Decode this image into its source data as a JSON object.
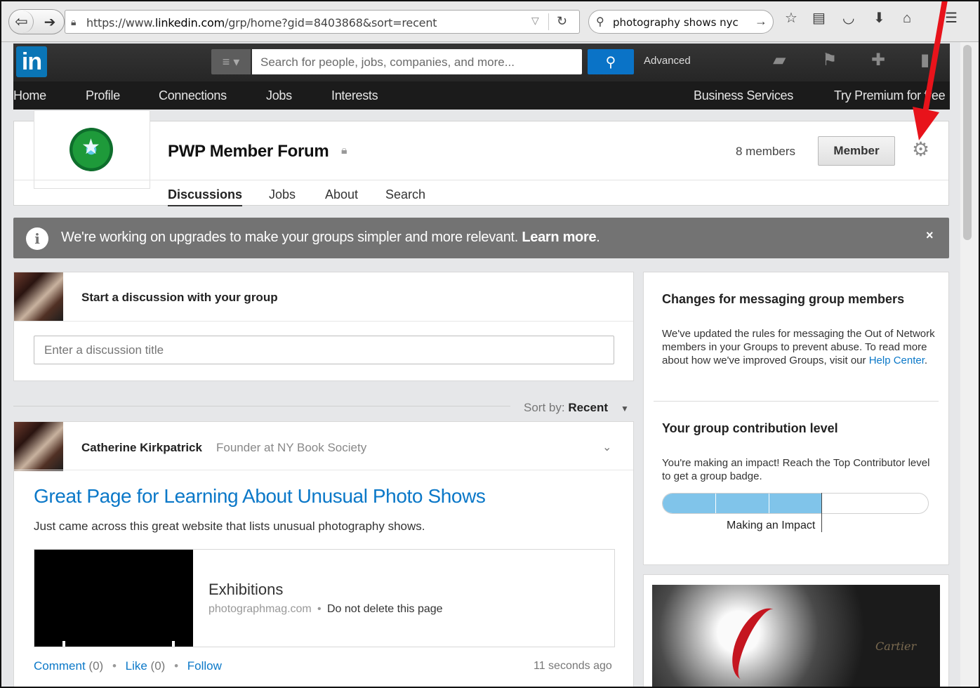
{
  "browser": {
    "url_prefix": "https://www.",
    "url_domain": "linkedin.com",
    "url_path": "/grp/home?gid=8403868&sort=recent",
    "search_query": "photography shows nyc"
  },
  "linkedin": {
    "logo": "in",
    "search_placeholder": "Search for people, jobs, companies, and more...",
    "advanced_label": "Advanced",
    "nav": [
      "Home",
      "Profile",
      "Connections",
      "Jobs",
      "Interests",
      "Business Services",
      "Try Premium for free"
    ]
  },
  "group": {
    "title": "PWP Member Forum",
    "members": "8 members",
    "member_button": "Member",
    "tabs": [
      "Discussions",
      "Jobs",
      "About",
      "Search"
    ]
  },
  "notice": {
    "text": "We're working on upgrades to make your groups simpler and more relevant.",
    "link": "Learn more",
    "suffix": ".",
    "close": "×"
  },
  "composer": {
    "title": "Start a discussion with your group",
    "placeholder": "Enter a discussion title"
  },
  "sort": {
    "label": "Sort by:",
    "value": "Recent"
  },
  "post": {
    "author": "Catherine Kirkpatrick",
    "headline": "Founder at NY Book Society",
    "title": "Great Page for Learning About Unusual Photo Shows",
    "body": "Just came across this great website that lists unusual photography shows.",
    "link_title": "Exhibitions",
    "link_domain": "photographmag.com",
    "link_desc": "Do not delete this page",
    "comment_label": "Comment",
    "comment_count": "(0)",
    "like_label": "Like",
    "like_count": "(0)",
    "follow_label": "Follow",
    "time": "11 seconds ago"
  },
  "sidebar": {
    "messaging_title": "Changes for messaging group members",
    "messaging_text": "We've updated the rules for messaging the Out of Network members in your Groups to prevent abuse. To read more about how we've improved Groups, visit our",
    "messaging_link": "Help Center",
    "messaging_suffix": ".",
    "contrib_title": "Your group contribution level",
    "contrib_text": "You're making an impact! Reach the Top Contributor level to get a group badge.",
    "contrib_level_label": "Making an Impact",
    "contrib_progress": 0.6,
    "ad_brand": "Cartier"
  },
  "colors": {
    "linkedin_blue": "#0a75b6",
    "link_blue": "#0b78c8",
    "annotation_red": "#e8131b"
  }
}
